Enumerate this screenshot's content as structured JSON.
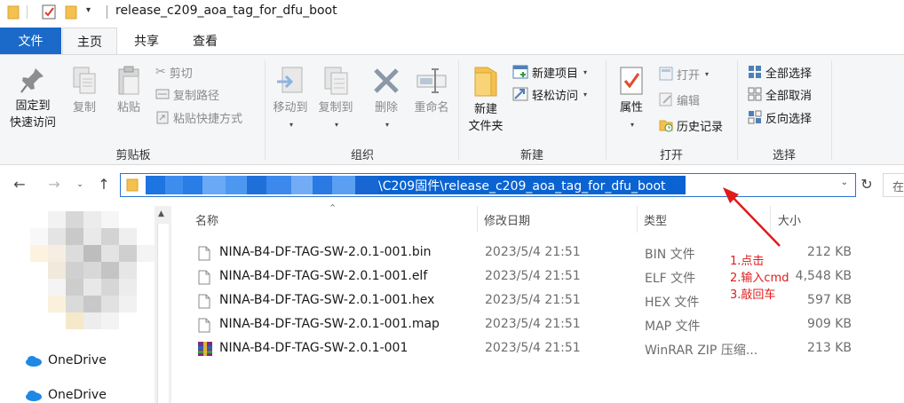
{
  "window": {
    "title": "release_c209_aoa_tag_for_dfu_boot"
  },
  "tabs": {
    "file": "文件",
    "home": "主页",
    "share": "共享",
    "view": "查看"
  },
  "ribbon": {
    "clipboard": {
      "label": "剪贴板",
      "pin_line1": "固定到",
      "pin_line2": "快速访问",
      "copy": "复制",
      "paste": "粘贴",
      "cut": "剪切",
      "copy_path": "复制路径",
      "paste_shortcut": "粘贴快捷方式"
    },
    "organize": {
      "label": "组织",
      "move_to": "移动到",
      "copy_to": "复制到",
      "delete": "删除",
      "rename": "重命名"
    },
    "new": {
      "label": "新建",
      "new_folder_line1": "新建",
      "new_folder_line2": "文件夹",
      "new_item": "新建项目",
      "easy_access": "轻松访问"
    },
    "open": {
      "label": "打开",
      "properties": "属性",
      "open": "打开",
      "edit": "编辑",
      "history": "历史记录"
    },
    "select": {
      "label": "选择",
      "select_all": "全部选择",
      "select_none": "全部取消",
      "invert": "反向选择"
    }
  },
  "address": {
    "path_visible": "\\C209固件\\release_c209_aoa_tag_for_dfu_boot",
    "search_placeholder": "在"
  },
  "navpane": {
    "items": [
      {
        "label": "OneDrive"
      },
      {
        "label": "OneDrive"
      }
    ]
  },
  "columns": {
    "name": "名称",
    "modified": "修改日期",
    "type": "类型",
    "size": "大小"
  },
  "files": [
    {
      "name": "NINA-B4-DF-TAG-SW-2.0.1-001.bin",
      "modified": "2023/5/4 21:51",
      "type": "BIN 文件",
      "size": "212 KB",
      "icon": "file-icon"
    },
    {
      "name": "NINA-B4-DF-TAG-SW-2.0.1-001.elf",
      "modified": "2023/5/4 21:51",
      "type": "ELF 文件",
      "size": "4,548 KB",
      "icon": "file-icon"
    },
    {
      "name": "NINA-B4-DF-TAG-SW-2.0.1-001.hex",
      "modified": "2023/5/4 21:51",
      "type": "HEX 文件",
      "size": "597 KB",
      "icon": "file-icon"
    },
    {
      "name": "NINA-B4-DF-TAG-SW-2.0.1-001.map",
      "modified": "2023/5/4 21:51",
      "type": "MAP 文件",
      "size": "909 KB",
      "icon": "file-icon"
    },
    {
      "name": "NINA-B4-DF-TAG-SW-2.0.1-001",
      "modified": "2023/5/4 21:51",
      "type": "WinRAR ZIP 压缩...",
      "size": "213 KB",
      "icon": "winrar-icon"
    }
  ],
  "annotation": {
    "step1": "1.点击",
    "step2": "2.输入cmd",
    "step3": "3.敲回车"
  },
  "colors": {
    "accent": "#1b6ac9",
    "selection": "#0a63d1",
    "annotation": "#e01b1b",
    "folder": "#f4c14f"
  }
}
